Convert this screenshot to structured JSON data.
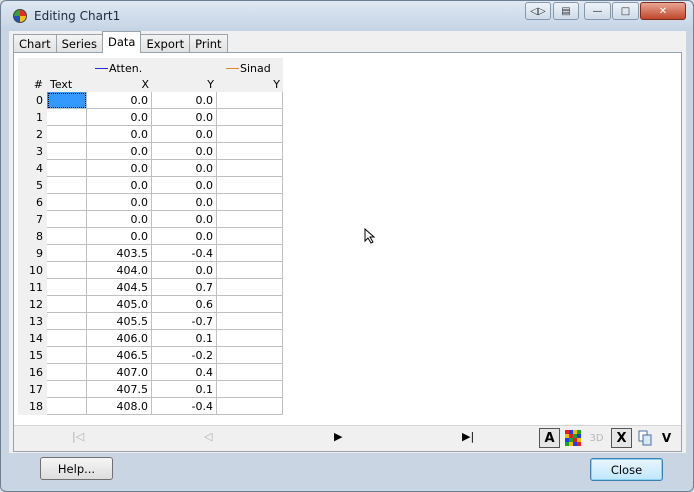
{
  "window": {
    "title": "Editing Chart1"
  },
  "tabs": [
    {
      "label": "Chart",
      "active": false
    },
    {
      "label": "Series",
      "active": false
    },
    {
      "label": "Data",
      "active": true
    },
    {
      "label": "Export",
      "active": false
    },
    {
      "label": "Print",
      "active": false
    }
  ],
  "legend": [
    {
      "label": "Atten.",
      "color": "#2b2bd0"
    },
    {
      "label": "Sinad",
      "color": "#e08a2a"
    }
  ],
  "grid": {
    "headers": {
      "num": "#",
      "text": "Text",
      "x": "X",
      "y": "Y",
      "y2": "Y"
    },
    "rows": [
      {
        "num": "0",
        "text": "",
        "x": "0.0",
        "y": "0.0",
        "y2": ""
      },
      {
        "num": "1",
        "text": "",
        "x": "0.0",
        "y": "0.0",
        "y2": ""
      },
      {
        "num": "2",
        "text": "",
        "x": "0.0",
        "y": "0.0",
        "y2": ""
      },
      {
        "num": "3",
        "text": "",
        "x": "0.0",
        "y": "0.0",
        "y2": ""
      },
      {
        "num": "4",
        "text": "",
        "x": "0.0",
        "y": "0.0",
        "y2": ""
      },
      {
        "num": "5",
        "text": "",
        "x": "0.0",
        "y": "0.0",
        "y2": ""
      },
      {
        "num": "6",
        "text": "",
        "x": "0.0",
        "y": "0.0",
        "y2": ""
      },
      {
        "num": "7",
        "text": "",
        "x": "0.0",
        "y": "0.0",
        "y2": ""
      },
      {
        "num": "8",
        "text": "",
        "x": "0.0",
        "y": "0.0",
        "y2": ""
      },
      {
        "num": "9",
        "text": "",
        "x": "403.5",
        "y": "-0.4",
        "y2": ""
      },
      {
        "num": "10",
        "text": "",
        "x": "404.0",
        "y": "0.0",
        "y2": ""
      },
      {
        "num": "11",
        "text": "",
        "x": "404.5",
        "y": "0.7",
        "y2": ""
      },
      {
        "num": "12",
        "text": "",
        "x": "405.0",
        "y": "0.6",
        "y2": ""
      },
      {
        "num": "13",
        "text": "",
        "x": "405.5",
        "y": "-0.7",
        "y2": ""
      },
      {
        "num": "14",
        "text": "",
        "x": "406.0",
        "y": "0.1",
        "y2": ""
      },
      {
        "num": "15",
        "text": "",
        "x": "406.5",
        "y": "-0.2",
        "y2": ""
      },
      {
        "num": "16",
        "text": "",
        "x": "407.0",
        "y": "0.4",
        "y2": ""
      },
      {
        "num": "17",
        "text": "",
        "x": "407.5",
        "y": "0.1",
        "y2": ""
      },
      {
        "num": "18",
        "text": "",
        "x": "408.0",
        "y": "-0.4",
        "y2": ""
      }
    ]
  },
  "navigator": {
    "first": "|◁",
    "prior": "◁",
    "next": "▶",
    "last": "▶|"
  },
  "toolbar": {
    "font_label": "A",
    "threed_label": "3D",
    "delete_label": "X",
    "more_label": "V"
  },
  "buttons": {
    "help": "Help...",
    "close": "Close"
  }
}
